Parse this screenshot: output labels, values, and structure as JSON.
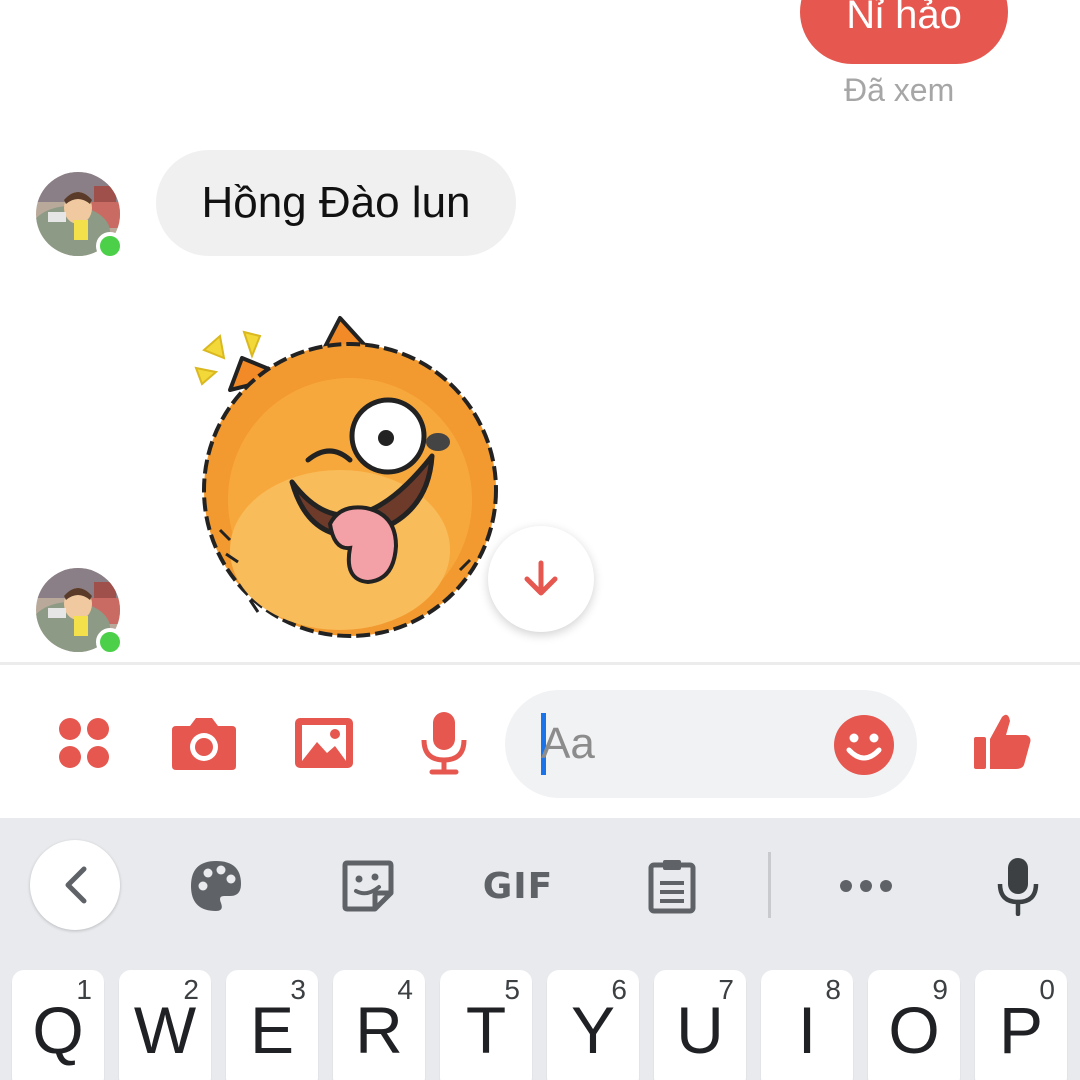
{
  "colors": {
    "accent": "#e5574f",
    "online": "#4cd04a",
    "caret": "#1a73e8",
    "keyboard_bg": "#e8eaed"
  },
  "chat": {
    "outgoing_message": "Nỉ hảo",
    "seen_status": "Đã xem",
    "incoming_message": "Hồng Đào lun",
    "sticker": "smiling-fox-sticker"
  },
  "composer": {
    "icons": [
      "apps-icon",
      "camera-icon",
      "image-icon",
      "microphone-icon"
    ],
    "input_placeholder": "Aa",
    "emoji_icon": "smiley-icon",
    "like_icon": "thumbs-up-icon"
  },
  "keyboard_toolbar": {
    "items": [
      "back-icon",
      "palette-icon",
      "sticker-icon",
      "GIF",
      "clipboard-icon",
      "more-icon",
      "voice-input-icon"
    ],
    "gif_label": "GIF"
  },
  "keyboard_row": [
    {
      "letter": "Q",
      "hint": "1"
    },
    {
      "letter": "W",
      "hint": "2"
    },
    {
      "letter": "E",
      "hint": "3"
    },
    {
      "letter": "R",
      "hint": "4"
    },
    {
      "letter": "T",
      "hint": "5"
    },
    {
      "letter": "Y",
      "hint": "6"
    },
    {
      "letter": "U",
      "hint": "7"
    },
    {
      "letter": "I",
      "hint": "8"
    },
    {
      "letter": "O",
      "hint": "9"
    },
    {
      "letter": "P",
      "hint": "0"
    }
  ]
}
